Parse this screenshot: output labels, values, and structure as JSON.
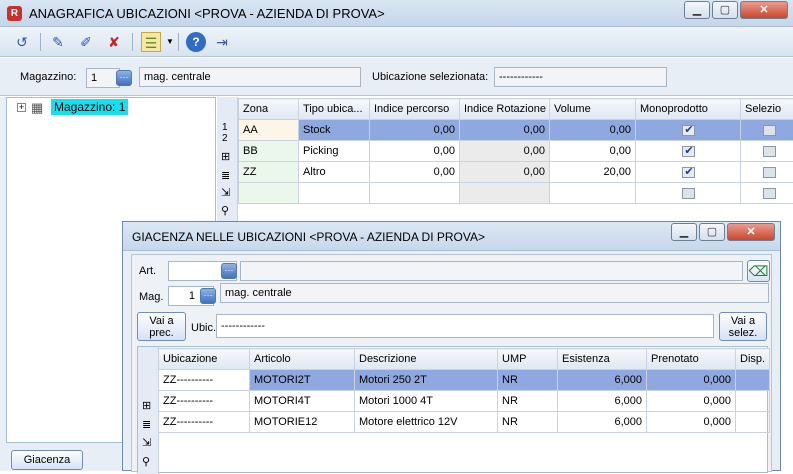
{
  "main": {
    "title": "ANAGRAFICA UBICAZIONI <PROVA - AZIENDA DI PROVA>",
    "mag_label": "Magazzino:",
    "mag_num": "1",
    "mag_desc": "mag. centrale",
    "ubic_sel_label": "Ubicazione selezionata:",
    "ubic_sel_value": "------------",
    "tree_node": "Magazzino: 1",
    "columns": [
      "Zona",
      "Tipo ubica...",
      "Indice percorso",
      "Indice Rotazione",
      "Volume",
      "Monoprodotto",
      "Selezio"
    ],
    "rows": [
      [
        "AA",
        "Stock",
        "0,00",
        "0,00",
        "0,00"
      ],
      [
        "BB",
        "Picking",
        "0,00",
        "0,00",
        "0,00"
      ],
      [
        "ZZ",
        "Altro",
        "0,00",
        "0,00",
        "20,00"
      ]
    ],
    "row_hdr": "1\n2",
    "giacenza_button": "Giacenza"
  },
  "dialog": {
    "title": "GIACENZA NELLE UBICAZIONI <PROVA - AZIENDA DI PROVA>",
    "art_label": "Art.",
    "mag_label": "Mag.",
    "mag_num": "1",
    "mag_desc": "mag. centrale",
    "prev_button": "Vai a prec.",
    "ubic_label": "Ubic.",
    "ubic_value": "------------",
    "next_button": "Vai a selez.",
    "columns": [
      "Ubicazione",
      "Articolo",
      "Descrizione",
      "UMP",
      "Esistenza",
      "Prenotato",
      "Disp."
    ],
    "rows": [
      [
        "ZZ----------",
        "MOTORI2T",
        "Motori 250 2T",
        "NR",
        "6,000",
        "0,000"
      ],
      [
        "ZZ----------",
        "MOTORI4T",
        "Motori 1000 4T",
        "NR",
        "6,000",
        "0,000"
      ],
      [
        "ZZ----------",
        "MOTORIE12",
        "Motore elettrico 12V",
        "NR",
        "6,000",
        "0,000"
      ]
    ]
  }
}
